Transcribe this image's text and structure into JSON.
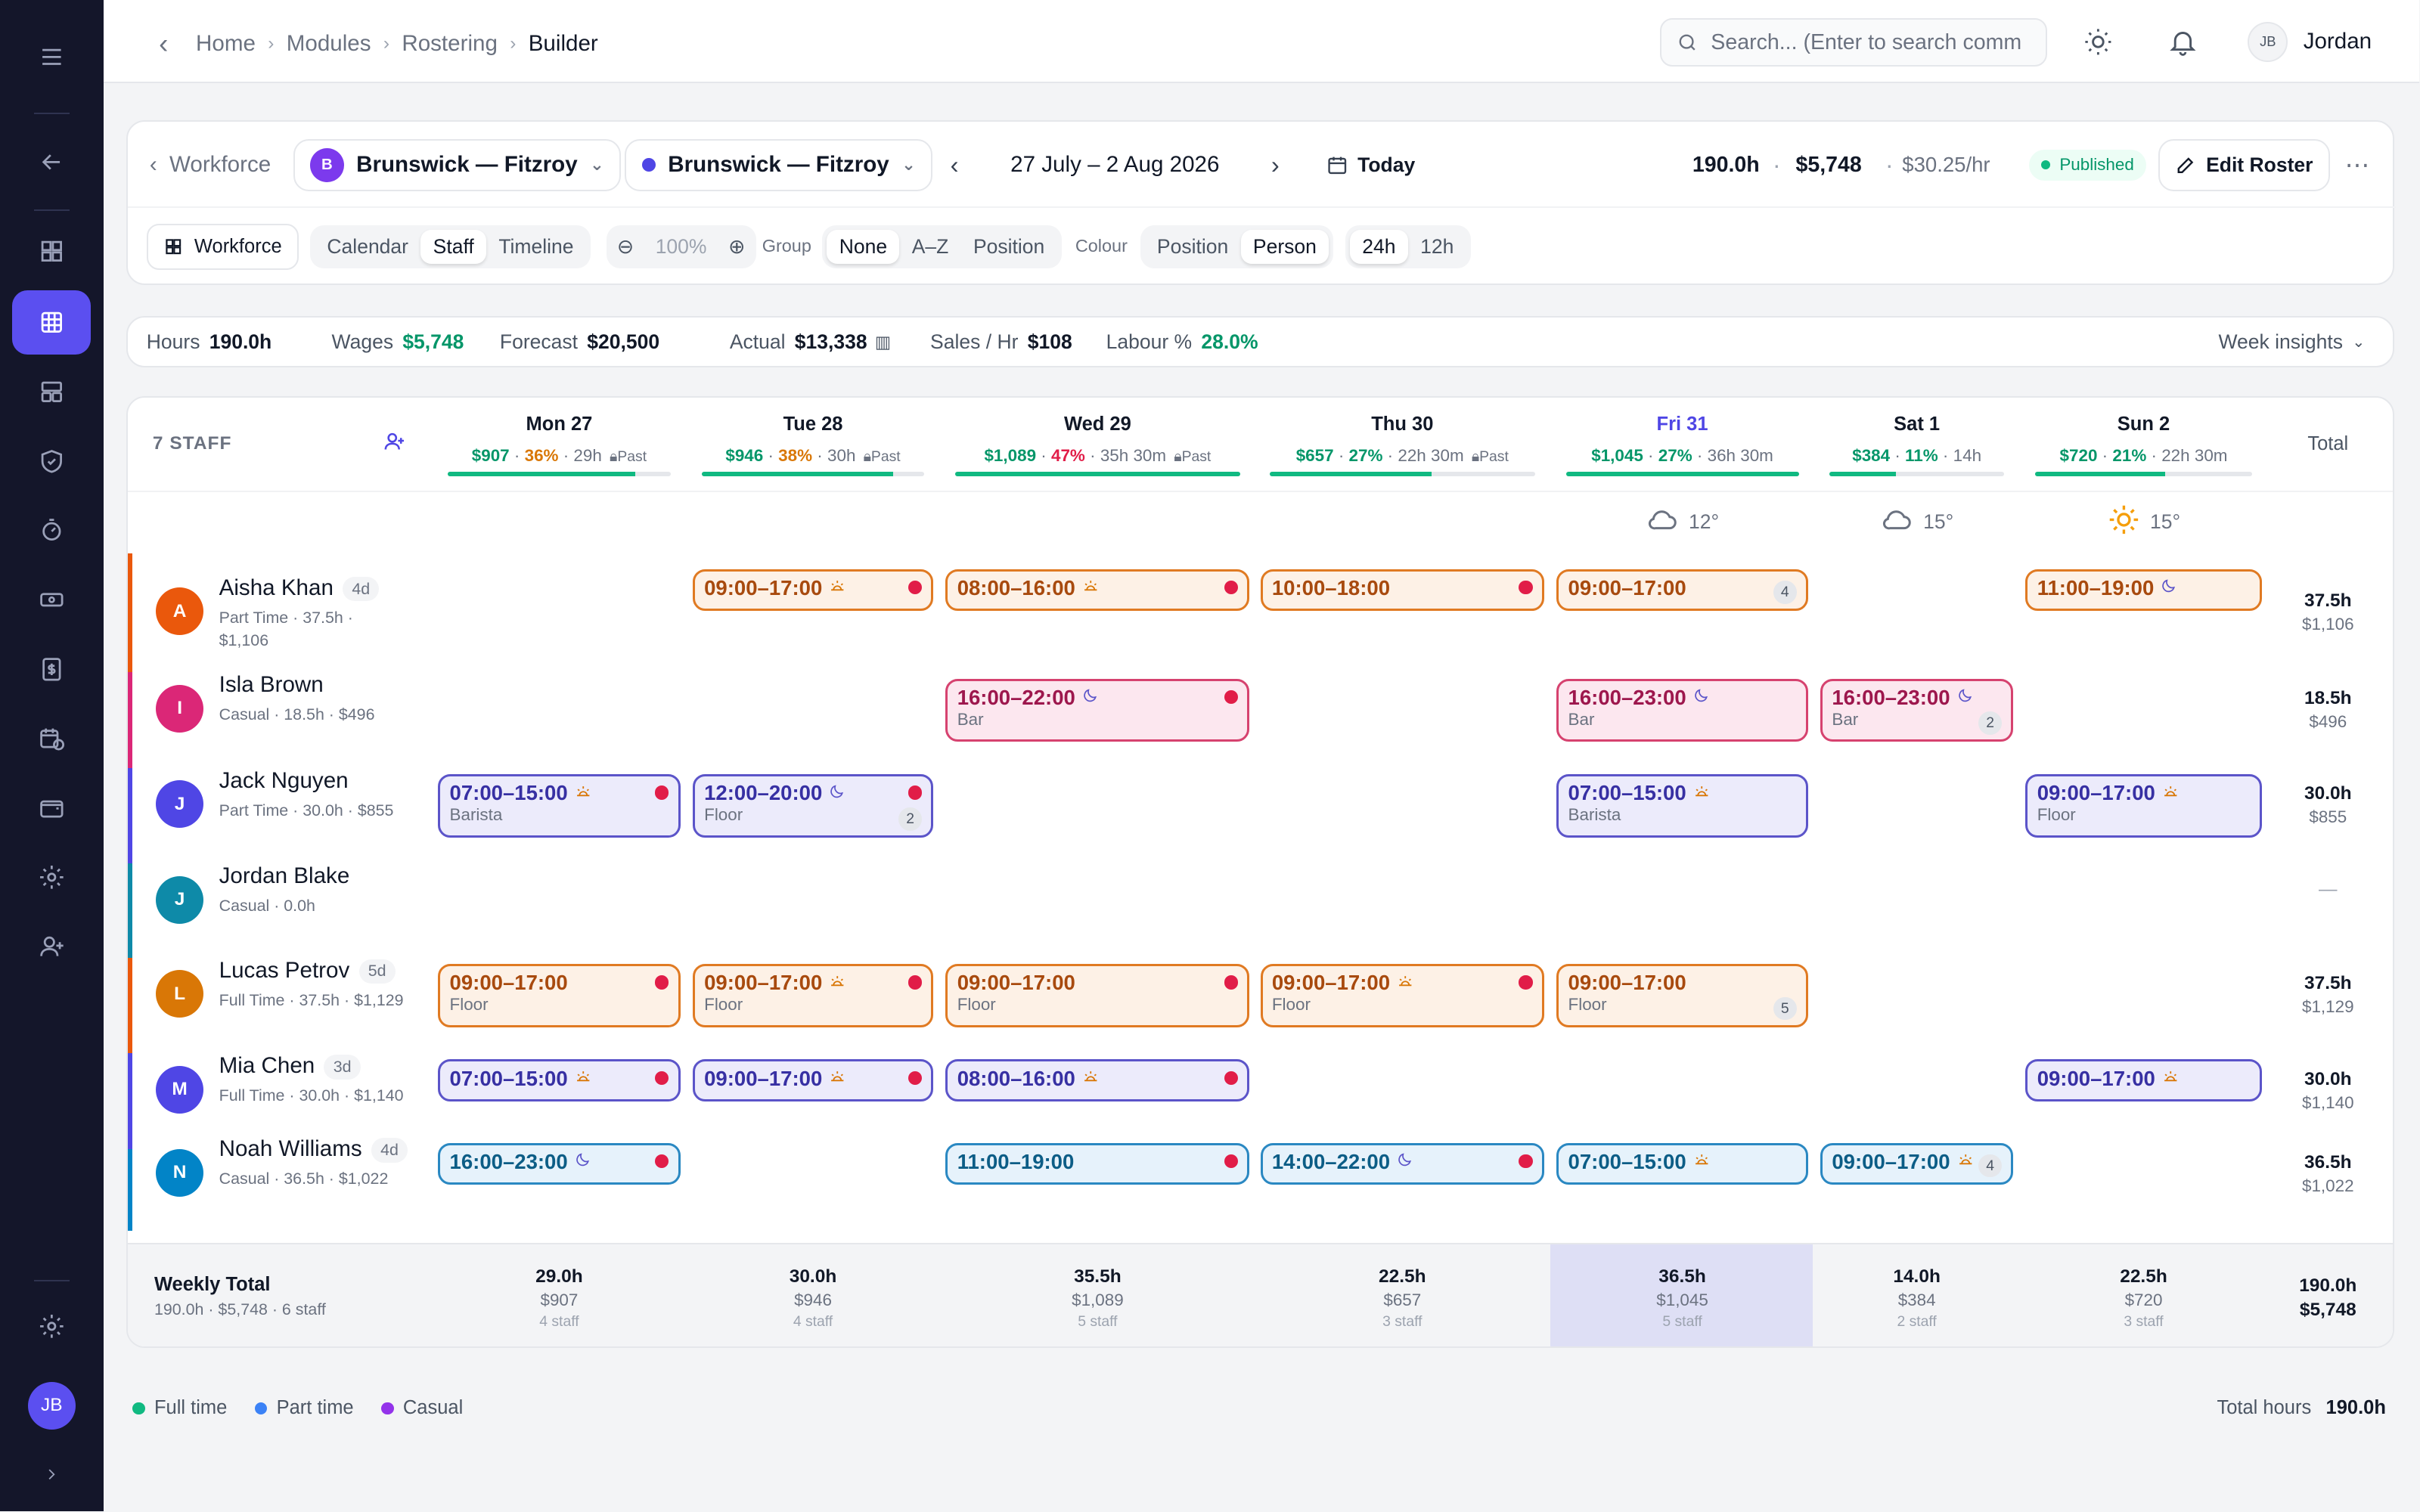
{
  "breadcrumb": {
    "items": [
      "Home",
      "Modules",
      "Rostering"
    ],
    "current": "Builder"
  },
  "search": {
    "placeholder": "Search... (Enter to search comm"
  },
  "user": {
    "initials": "JB",
    "name": "Jordan"
  },
  "toolbar": {
    "back_label": "Workforce",
    "location_initial": "B",
    "location": "Brunswick — Fitzroy",
    "location2": "Brunswick — Fitzroy",
    "date_range": "27 July – 2 Aug 2026",
    "today_label": "Today",
    "hours": "190.0h",
    "wages": "$5,748",
    "rate": "$30.25/hr",
    "status": "Published",
    "edit_label": "Edit Roster"
  },
  "view": {
    "workforce_label": "Workforce",
    "modes": [
      "Calendar",
      "Staff",
      "Timeline"
    ],
    "mode_selected": "Staff",
    "zoom": "100%",
    "group_label": "Group",
    "group_options": [
      "None",
      "A–Z",
      "Position"
    ],
    "group_selected": "None",
    "colour_label": "Colour",
    "colour_options": [
      "Position",
      "Person"
    ],
    "colour_selected": "Person",
    "time_options": [
      "24h",
      "12h"
    ],
    "time_selected": "24h"
  },
  "summary": {
    "hours_label": "Hours",
    "hours": "190.0h",
    "wages_label": "Wages",
    "wages": "$5,748",
    "forecast_label": "Forecast",
    "forecast": "$20,500",
    "actual_label": "Actual",
    "actual": "$13,338",
    "sph_label": "Sales / Hr",
    "sph": "$108",
    "labour_label": "Labour %",
    "labour": "28.0%",
    "insights_label": "Week insights"
  },
  "grid": {
    "staff_count": "7 STAFF",
    "total_label": "Total",
    "days": [
      {
        "name": "Mon 27",
        "wage": "$907",
        "pct": "36%",
        "hours": "29h",
        "past": "Past",
        "progress": 0.84,
        "pct_color": "#d97706"
      },
      {
        "name": "Tue 28",
        "wage": "$946",
        "pct": "38%",
        "hours": "30h",
        "past": "Past",
        "progress": 0.86,
        "pct_color": "#d97706"
      },
      {
        "name": "Wed 29",
        "wage": "$1,089",
        "pct": "47%",
        "hours": "35h 30m",
        "past": "Past",
        "progress": 1.0,
        "pct_color": "#e11d48"
      },
      {
        "name": "Thu 30",
        "wage": "$657",
        "pct": "27%",
        "hours": "22h 30m",
        "past": "Past",
        "progress": 0.61,
        "pct_color": "#059669"
      },
      {
        "name": "Fri 31",
        "wage": "$1,045",
        "pct": "27%",
        "hours": "36h 30m",
        "past": "",
        "progress": 1.0,
        "pct_color": "#059669"
      },
      {
        "name": "Sat 1",
        "wage": "$384",
        "pct": "11%",
        "hours": "14h",
        "past": "",
        "progress": 0.38,
        "pct_color": "#059669"
      },
      {
        "name": "Sun 2",
        "wage": "$720",
        "pct": "21%",
        "hours": "22h 30m",
        "past": "",
        "progress": 0.6,
        "pct_color": "#059669"
      }
    ],
    "weather": [
      {
        "day": 4,
        "icon": "cloud-icon",
        "temp": "12°"
      },
      {
        "day": 5,
        "icon": "cloud-icon",
        "temp": "15°"
      },
      {
        "day": 6,
        "icon": "sun-icon",
        "temp": "15°"
      }
    ],
    "staff": [
      {
        "initial": "A",
        "name": "Aisha Khan",
        "badge": "4d",
        "sub": [
          "Part Time · 37.5h ·",
          "$1,106"
        ],
        "color": "#ea580c",
        "accent": "#ea580c",
        "total_h": "37.5h",
        "total_w": "$1,106",
        "shifts": [
          {
            "day": 1,
            "time": "09:00–17:00",
            "icon": "sun",
            "pos": "",
            "dot": true,
            "color": "or"
          },
          {
            "day": 2,
            "time": "08:00–16:00",
            "icon": "sun",
            "pos": "",
            "dot": true,
            "color": "or"
          },
          {
            "day": 3,
            "time": "10:00–18:00",
            "icon": "",
            "pos": "",
            "dot": true,
            "color": "or"
          },
          {
            "day": 4,
            "time": "09:00–17:00",
            "icon": "",
            "pos": "",
            "dot": false,
            "count": "4",
            "color": "or"
          },
          {
            "day": 6,
            "time": "11:00–19:00",
            "icon": "moon",
            "pos": "",
            "dot": false,
            "color": "or"
          }
        ]
      },
      {
        "initial": "I",
        "name": "Isla Brown",
        "badge": "",
        "sub": [
          "Casual · 18.5h · $496"
        ],
        "color": "#db2777",
        "accent": "#db2777",
        "total_h": "18.5h",
        "total_w": "$496",
        "shifts": [
          {
            "day": 2,
            "time": "16:00–22:00",
            "icon": "moon",
            "pos": "Bar",
            "dot": true,
            "color": "pk"
          },
          {
            "day": 4,
            "time": "16:00–23:00",
            "icon": "moon",
            "pos": "Bar",
            "dot": false,
            "color": "pk"
          },
          {
            "day": 5,
            "time": "16:00–23:00",
            "icon": "moon",
            "pos": "Bar",
            "dot": false,
            "count": "2",
            "color": "pk"
          }
        ]
      },
      {
        "initial": "J",
        "name": "Jack Nguyen",
        "badge": "",
        "sub": [
          "Part Time · 30.0h · $855"
        ],
        "color": "#4f46e5",
        "accent": "#4f46e5",
        "total_h": "30.0h",
        "total_w": "$855",
        "shifts": [
          {
            "day": 0,
            "time": "07:00–15:00",
            "icon": "sun",
            "pos": "Barista",
            "dot": true,
            "color": "pu"
          },
          {
            "day": 1,
            "time": "12:00–20:00",
            "icon": "moon",
            "pos": "Floor",
            "dot": true,
            "count": "2",
            "color": "pu"
          },
          {
            "day": 4,
            "time": "07:00–15:00",
            "icon": "sun",
            "pos": "Barista",
            "dot": false,
            "color": "pu"
          },
          {
            "day": 6,
            "time": "09:00–17:00",
            "icon": "sun",
            "pos": "Floor",
            "dot": false,
            "color": "pu"
          }
        ]
      },
      {
        "initial": "J",
        "name": "Jordan Blake",
        "badge": "",
        "sub": [
          "Casual · 0.0h"
        ],
        "color": "#0e8aa8",
        "accent": "#0e8aa8",
        "total_h": "—",
        "total_w": "",
        "shifts": []
      },
      {
        "initial": "L",
        "name": "Lucas Petrov",
        "badge": "5d",
        "sub": [
          "Full Time · 37.5h · $1,129"
        ],
        "color": "#d97706",
        "accent": "#ea580c",
        "total_h": "37.5h",
        "total_w": "$1,129",
        "shifts": [
          {
            "day": 0,
            "time": "09:00–17:00",
            "icon": "",
            "pos": "Floor",
            "dot": true,
            "color": "or"
          },
          {
            "day": 1,
            "time": "09:00–17:00",
            "icon": "sun",
            "pos": "Floor",
            "dot": true,
            "color": "or"
          },
          {
            "day": 2,
            "time": "09:00–17:00",
            "icon": "",
            "pos": "Floor",
            "dot": true,
            "color": "or"
          },
          {
            "day": 3,
            "time": "09:00–17:00",
            "icon": "sun",
            "pos": "Floor",
            "dot": true,
            "color": "or"
          },
          {
            "day": 4,
            "time": "09:00–17:00",
            "icon": "",
            "pos": "Floor",
            "dot": false,
            "count": "5",
            "color": "or"
          }
        ]
      },
      {
        "initial": "M",
        "name": "Mia Chen",
        "badge": "3d",
        "sub": [
          "Full Time · 30.0h · $1,140"
        ],
        "color": "#4f46e5",
        "accent": "#4f46e5",
        "total_h": "30.0h",
        "total_w": "$1,140",
        "shifts": [
          {
            "day": 0,
            "time": "07:00–15:00",
            "icon": "sun",
            "pos": "",
            "dot": true,
            "color": "pu"
          },
          {
            "day": 1,
            "time": "09:00–17:00",
            "icon": "sun",
            "pos": "",
            "dot": true,
            "color": "pu"
          },
          {
            "day": 2,
            "time": "08:00–16:00",
            "icon": "sun",
            "pos": "",
            "dot": true,
            "color": "pu"
          },
          {
            "day": 6,
            "time": "09:00–17:00",
            "icon": "sun",
            "pos": "",
            "dot": false,
            "color": "pu"
          }
        ]
      },
      {
        "initial": "N",
        "name": "Noah Williams",
        "badge": "4d",
        "sub": [
          "Casual · 36.5h · $1,022"
        ],
        "color": "#0284c7",
        "accent": "#0284c7",
        "total_h": "36.5h",
        "total_w": "$1,022",
        "shifts": [
          {
            "day": 0,
            "time": "16:00–23:00",
            "icon": "moon",
            "pos": "",
            "dot": true,
            "color": "bl"
          },
          {
            "day": 2,
            "time": "11:00–19:00",
            "icon": "",
            "pos": "",
            "dot": true,
            "color": "bl"
          },
          {
            "day": 3,
            "time": "14:00–22:00",
            "icon": "moon",
            "pos": "",
            "dot": true,
            "color": "bl"
          },
          {
            "day": 4,
            "time": "07:00–15:00",
            "icon": "sun",
            "pos": "",
            "dot": false,
            "color": "bl"
          },
          {
            "day": 5,
            "time": "09:00–17:00",
            "icon": "sun",
            "pos": "",
            "dot": false,
            "count": "4",
            "color": "bl"
          }
        ]
      }
    ],
    "weekly": {
      "label": "Weekly Total",
      "sub": "190.0h · $5,748 · 6 staff",
      "total_h": "190.0h",
      "total_w": "$5,748",
      "days": [
        {
          "h": "29.0h",
          "w": "$907",
          "s": "4 staff"
        },
        {
          "h": "30.0h",
          "w": "$946",
          "s": "4 staff"
        },
        {
          "h": "35.5h",
          "w": "$1,089",
          "s": "5 staff"
        },
        {
          "h": "22.5h",
          "w": "$657",
          "s": "3 staff"
        },
        {
          "h": "36.5h",
          "w": "$1,045",
          "s": "5 staff"
        },
        {
          "h": "14.0h",
          "w": "$384",
          "s": "2 staff"
        },
        {
          "h": "22.5h",
          "w": "$720",
          "s": "3 staff"
        }
      ]
    }
  },
  "legend": {
    "items": [
      {
        "label": "Full time",
        "color": "#10b981"
      },
      {
        "label": "Part time",
        "color": "#3b82f6"
      },
      {
        "label": "Casual",
        "color": "#9333ea"
      }
    ],
    "total_label": "Total hours",
    "total": "190.0h"
  }
}
